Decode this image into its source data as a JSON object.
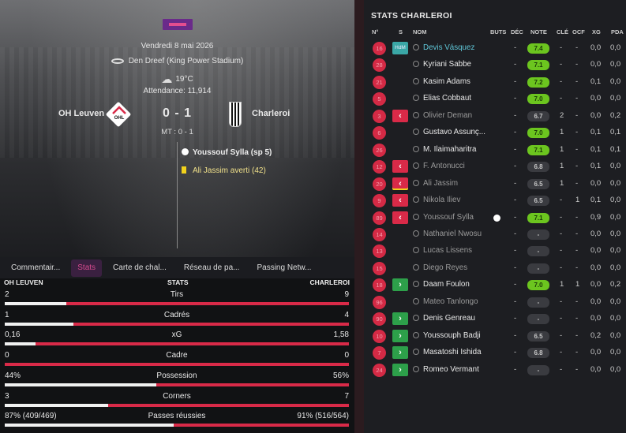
{
  "match": {
    "league_logo": "league-logo",
    "date": "Vendredi 8 mai 2026",
    "stadium": "Den Dreef (King Power Stadium)",
    "temperature": "19°C",
    "attendance": "Attendance: 11,914",
    "home_team": "OH Leuven",
    "away_team": "Charleroi",
    "score": "0 - 1",
    "halftime": "MT : 0 - 1",
    "home_crest_text": "OHL",
    "events": [
      {
        "icon": "ball-icon",
        "text": "Youssouf Sylla (sp 5)"
      },
      {
        "icon": "yellow-card-icon",
        "text": "Ali Jassim averti (42)"
      }
    ]
  },
  "tabs": [
    "Commentair...",
    "Stats",
    "Carte de chal...",
    "Réseau de pa...",
    "Passing Netw..."
  ],
  "stats": {
    "home_label": "OH LEUVEN",
    "center_label": "STATS",
    "away_label": "CHARLEROI",
    "rows": [
      {
        "label": "Tirs",
        "home": "2",
        "away": "9",
        "home_share": 0.18
      },
      {
        "label": "Cadrés",
        "home": "1",
        "away": "4",
        "home_share": 0.2
      },
      {
        "label": "xG",
        "home": "0,16",
        "away": "1,58",
        "home_share": 0.09
      },
      {
        "label": "Cadre",
        "home": "0",
        "away": "0",
        "home_share": 0.0
      },
      {
        "label": "Possession",
        "home": "44%",
        "away": "56%",
        "home_share": 0.44
      },
      {
        "label": "Corners",
        "home": "3",
        "away": "7",
        "home_share": 0.3
      },
      {
        "label": "Passes réussies",
        "home": "87% (409/469)",
        "away": "91% (516/564)",
        "home_share": 0.49
      }
    ]
  },
  "player_table": {
    "title": "STATS CHARLEROI",
    "columns": [
      "N°",
      "S",
      "NOM",
      "BUTS",
      "DÉC",
      "NOTE",
      "CLÉ",
      "OCF",
      "XG",
      "PDA"
    ],
    "players": [
      {
        "num": "16",
        "sub": "HdM",
        "name": "Devis Vásquez",
        "goal": false,
        "buts": "",
        "dec": "-",
        "note": "7.4",
        "cle": "-",
        "ocf": "-",
        "xg": "0,0",
        "pda": "0,0",
        "style": "star",
        "rated": true
      },
      {
        "num": "28",
        "sub": "",
        "name": "Kyriani Sabbe",
        "goal": false,
        "buts": "",
        "dec": "-",
        "note": "7.1",
        "cle": "-",
        "ocf": "-",
        "xg": "0,0",
        "pda": "0,0",
        "style": "",
        "rated": true
      },
      {
        "num": "21",
        "sub": "",
        "name": "Kasim Adams",
        "goal": false,
        "buts": "",
        "dec": "-",
        "note": "7.2",
        "cle": "-",
        "ocf": "-",
        "xg": "0,1",
        "pda": "0,0",
        "style": "",
        "rated": true
      },
      {
        "num": "5",
        "sub": "",
        "name": "Elias Cobbaut",
        "goal": false,
        "buts": "",
        "dec": "-",
        "note": "7.0",
        "cle": "-",
        "ocf": "-",
        "xg": "0,0",
        "pda": "0,0",
        "style": "",
        "rated": true
      },
      {
        "num": "3",
        "sub": "out",
        "name": "Olivier Deman",
        "goal": false,
        "buts": "",
        "dec": "-",
        "note": "6.7",
        "cle": "2",
        "ocf": "-",
        "xg": "0,0",
        "pda": "0,2",
        "style": "dim",
        "rated": false
      },
      {
        "num": "6",
        "sub": "",
        "name": "Gustavo Assunç...",
        "goal": false,
        "buts": "",
        "dec": "-",
        "note": "7.0",
        "cle": "1",
        "ocf": "-",
        "xg": "0,1",
        "pda": "0,1",
        "style": "",
        "rated": true
      },
      {
        "num": "26",
        "sub": "",
        "name": "M. Ilaimaharitra",
        "goal": false,
        "buts": "",
        "dec": "-",
        "note": "7.1",
        "cle": "1",
        "ocf": "-",
        "xg": "0,1",
        "pda": "0,1",
        "style": "",
        "rated": true
      },
      {
        "num": "12",
        "sub": "out",
        "name": "F. Antonucci",
        "goal": false,
        "buts": "",
        "dec": "-",
        "note": "6.8",
        "cle": "1",
        "ocf": "-",
        "xg": "0,1",
        "pda": "0,0",
        "style": "dim",
        "rated": false
      },
      {
        "num": "20",
        "sub": "out-yellow",
        "name": "Ali Jassim",
        "goal": false,
        "buts": "",
        "dec": "-",
        "note": "6.5",
        "cle": "1",
        "ocf": "-",
        "xg": "0,0",
        "pda": "0,0",
        "style": "dim",
        "rated": false
      },
      {
        "num": "9",
        "sub": "out",
        "name": "Nikola Iliev",
        "goal": false,
        "buts": "",
        "dec": "-",
        "note": "6.5",
        "cle": "-",
        "ocf": "1",
        "xg": "0,1",
        "pda": "0,0",
        "style": "dim",
        "rated": false
      },
      {
        "num": "89",
        "sub": "out",
        "name": "Youssouf Sylla",
        "goal": true,
        "buts": "",
        "dec": "-",
        "note": "7.1",
        "cle": "-",
        "ocf": "-",
        "xg": "0,9",
        "pda": "0,0",
        "style": "dim",
        "rated": true
      },
      {
        "num": "14",
        "sub": "",
        "name": "Nathaniel Nwosu",
        "goal": false,
        "buts": "",
        "dec": "-",
        "note": "-",
        "cle": "-",
        "ocf": "-",
        "xg": "0,0",
        "pda": "0,0",
        "style": "dim",
        "rated": false
      },
      {
        "num": "13",
        "sub": "",
        "name": "Lucas Lissens",
        "goal": false,
        "buts": "",
        "dec": "-",
        "note": "-",
        "cle": "-",
        "ocf": "-",
        "xg": "0,0",
        "pda": "0,0",
        "style": "dim",
        "rated": false
      },
      {
        "num": "15",
        "sub": "",
        "name": "Diego Reyes",
        "goal": false,
        "buts": "",
        "dec": "-",
        "note": "-",
        "cle": "-",
        "ocf": "-",
        "xg": "0,0",
        "pda": "0,0",
        "style": "dim",
        "rated": false
      },
      {
        "num": "18",
        "sub": "in",
        "name": "Daam Foulon",
        "goal": false,
        "buts": "",
        "dec": "-",
        "note": "7.0",
        "cle": "1",
        "ocf": "1",
        "xg": "0,0",
        "pda": "0,2",
        "style": "",
        "rated": true
      },
      {
        "num": "96",
        "sub": "",
        "name": "Mateo Tanlongo",
        "goal": false,
        "buts": "",
        "dec": "-",
        "note": "-",
        "cle": "-",
        "ocf": "-",
        "xg": "0,0",
        "pda": "0,0",
        "style": "dim",
        "rated": false
      },
      {
        "num": "90",
        "sub": "in",
        "name": "Denis Genreau",
        "goal": false,
        "buts": "",
        "dec": "-",
        "note": "-",
        "cle": "-",
        "ocf": "-",
        "xg": "0,0",
        "pda": "0,0",
        "style": "",
        "rated": false
      },
      {
        "num": "10",
        "sub": "in",
        "name": "Youssouph Badji",
        "goal": false,
        "buts": "",
        "dec": "-",
        "note": "6.5",
        "cle": "-",
        "ocf": "-",
        "xg": "0,2",
        "pda": "0,0",
        "style": "",
        "rated": false
      },
      {
        "num": "7",
        "sub": "in",
        "name": "Masatoshi Ishida",
        "goal": false,
        "buts": "",
        "dec": "-",
        "note": "6.8",
        "cle": "-",
        "ocf": "-",
        "xg": "0,0",
        "pda": "0,0",
        "style": "",
        "rated": false
      },
      {
        "num": "24",
        "sub": "in",
        "name": "Romeo Vermant",
        "goal": false,
        "buts": "",
        "dec": "-",
        "note": "-",
        "cle": "-",
        "ocf": "-",
        "xg": "0,0",
        "pda": "0,0",
        "style": "",
        "rated": false
      }
    ]
  }
}
